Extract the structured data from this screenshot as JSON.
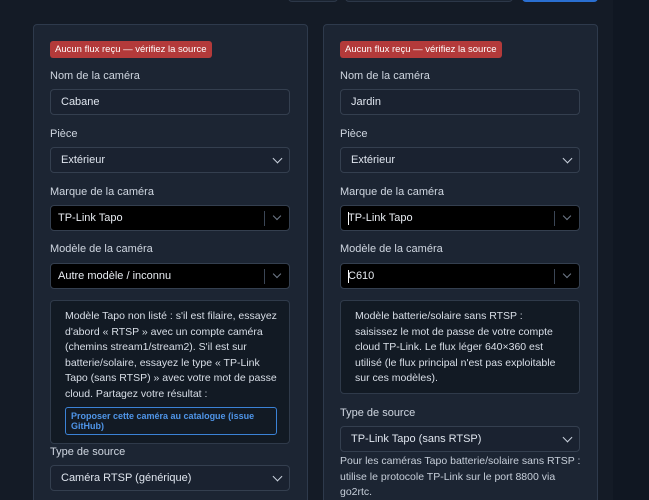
{
  "cards": [
    {
      "badge": "Aucun flux reçu — vérifiez la source",
      "name_label": "Nom de la caméra",
      "name_value": "Cabane",
      "room_label": "Pièce",
      "room_value": "Extérieur",
      "brand_label": "Marque de la caméra",
      "brand_value": "TP-Link Tapo",
      "model_label": "Modèle de la caméra",
      "model_value": "Autre modèle / inconnu",
      "note": "Modèle Tapo non listé : s'il est filaire, essayez d'abord « RTSP » avec un compte caméra (chemins stream1/stream2). S'il est sur batterie/solaire, essayez le type « TP-Link Tapo (sans RTSP) » avec votre mot de passe cloud. Partagez votre résultat :",
      "note_button": "Proposer cette caméra au catalogue (issue GitHub)",
      "source_label": "Type de source",
      "source_value": "Caméra RTSP (générique)"
    },
    {
      "badge": "Aucun flux reçu — vérifiez la source",
      "name_label": "Nom de la caméra",
      "name_value": "Jardin",
      "room_label": "Pièce",
      "room_value": "Extérieur",
      "brand_label": "Marque de la caméra",
      "brand_value": "TP-Link Tapo",
      "model_label": "Modèle de la caméra",
      "model_value": "C610",
      "note": "Modèle batterie/solaire sans RTSP : saisissez le mot de passe de votre compte cloud TP-Link. Le flux léger 640×360 est utilisé (le flux principal n'est pas exploitable sur ces modèles).",
      "source_label": "Type de source",
      "source_value": "TP-Link Tapo (sans RTSP)",
      "source_help": "Pour les caméras Tapo batterie/solaire sans RTSP : utilise le protocole TP-Link sur le port 8800 via go2rtc."
    }
  ]
}
